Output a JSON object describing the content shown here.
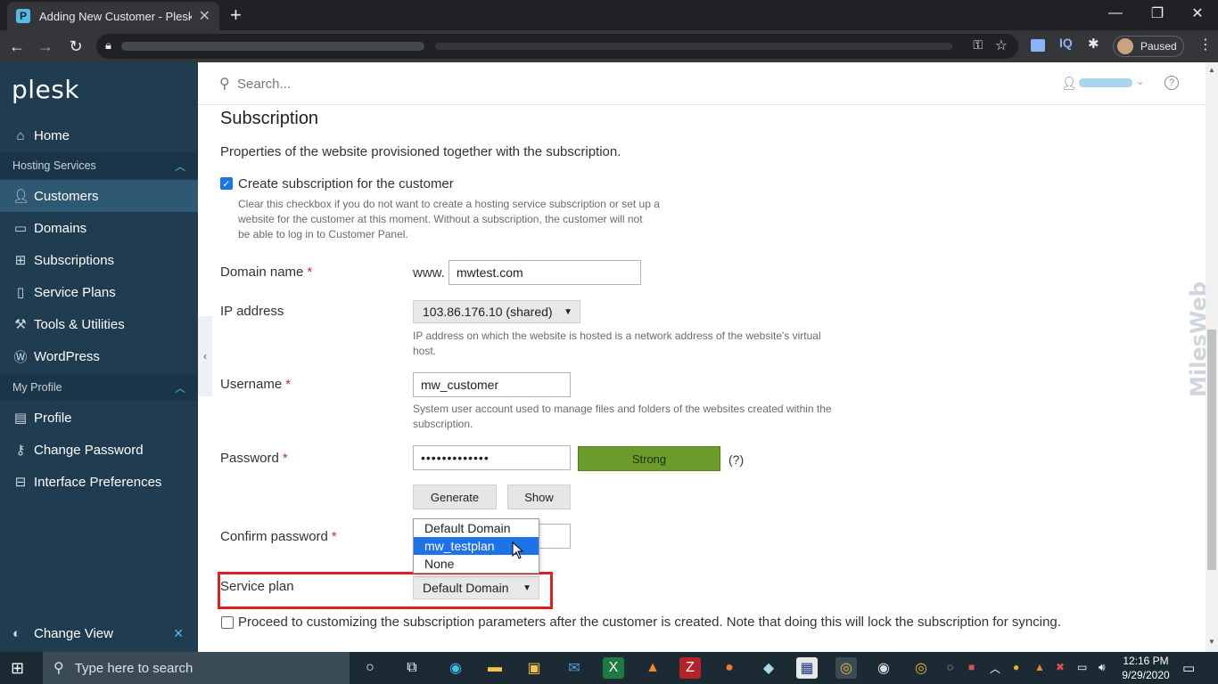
{
  "browser": {
    "tab_title": "Adding New Customer - Plesk Ob",
    "tab_favicon": "P",
    "new_tab": "+",
    "minimize": "—",
    "maximize": "❐",
    "close": "✕",
    "ext_iq": "IQ",
    "profile_status": "Paused"
  },
  "sidebar": {
    "logo": "plesk",
    "items": [
      {
        "label": "Home",
        "icon": "home-icon"
      },
      {
        "label": "Hosting Services",
        "group": true
      },
      {
        "label": "Customers",
        "icon": "user-icon",
        "active": true
      },
      {
        "label": "Domains",
        "icon": "monitor-icon"
      },
      {
        "label": "Subscriptions",
        "icon": "grid-icon"
      },
      {
        "label": "Service Plans",
        "icon": "book-icon"
      },
      {
        "label": "Tools & Utilities",
        "icon": "tools-icon"
      },
      {
        "label": "WordPress",
        "icon": "wordpress-icon"
      },
      {
        "label": "My Profile",
        "group": true
      },
      {
        "label": "Profile",
        "icon": "id-card-icon"
      },
      {
        "label": "Change Password",
        "icon": "key-icon"
      },
      {
        "label": "Interface Preferences",
        "icon": "layout-icon"
      }
    ],
    "footer": "Change View"
  },
  "header": {
    "search_placeholder": "Search...",
    "help": "?"
  },
  "form": {
    "section_title": "Subscription",
    "section_desc": "Properties of the website provisioned together with the subscription.",
    "create_subscription": {
      "label": "Create subscription for the customer",
      "checked": true,
      "hint_lines": [
        "Clear this checkbox if you do not want to create a hosting service subscription or set up a",
        "website for the customer at this moment. Without a subscription, the customer will not",
        "be able to log in to Customer Panel."
      ]
    },
    "domain_name": {
      "label": "Domain name",
      "prefix": "www.",
      "value": "mwtest.com"
    },
    "ip_address": {
      "label": "IP address",
      "value": "103.86.176.10 (shared)",
      "hint_lines": [
        "IP address on which the website is hosted is a network address of the website's virtual",
        "host."
      ]
    },
    "username": {
      "label": "Username",
      "value": "mw_customer",
      "hint_lines": [
        "System user account used to manage files and folders of the websites created within the",
        "subscription."
      ]
    },
    "password": {
      "label": "Password",
      "value": "•••••••••••••",
      "strength": "Strong",
      "help": "(?)"
    },
    "generate_button": "Generate",
    "show_button": "Show",
    "confirm_password": {
      "label": "Confirm password"
    },
    "service_plan": {
      "label": "Service plan",
      "value": "Default Domain",
      "options": [
        "Default Domain",
        "mw_testplan",
        "None"
      ],
      "highlighted": "mw_testplan"
    },
    "proceed": {
      "label": "Proceed to customizing the subscription parameters after the customer is created. Note that doing this will lock the subscription for syncing.",
      "checked": false
    },
    "required_mark": "*"
  },
  "taskbar": {
    "search_placeholder": "Type here to search",
    "time": "12:16 PM",
    "date": "9/29/2020"
  },
  "watermark": "MilesWeb",
  "colors": {
    "sidebar_bg": "#1f3c51",
    "sidebar_active": "#2f5872",
    "accent": "#52bbe6",
    "strength_green": "#6b9b2a",
    "highlight_red": "#e0201f",
    "dropdown_selected": "#1e73e8"
  }
}
